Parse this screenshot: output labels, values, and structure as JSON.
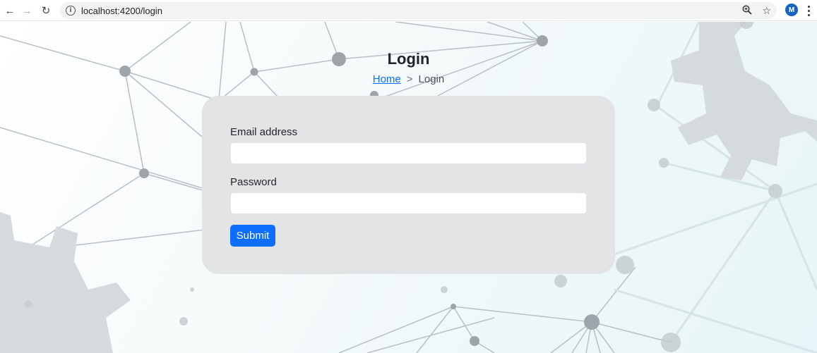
{
  "browser": {
    "url": "localhost:4200/login",
    "profile_initial": "M"
  },
  "page": {
    "title": "Login",
    "breadcrumb": {
      "home": "Home",
      "separator": ">",
      "current": "Login"
    }
  },
  "form": {
    "email_label": "Email address",
    "email_value": "",
    "password_label": "Password",
    "password_value": "",
    "submit_label": "Submit"
  },
  "colors": {
    "primary": "#0d6efd",
    "card_bg": "#e3e4e6"
  }
}
